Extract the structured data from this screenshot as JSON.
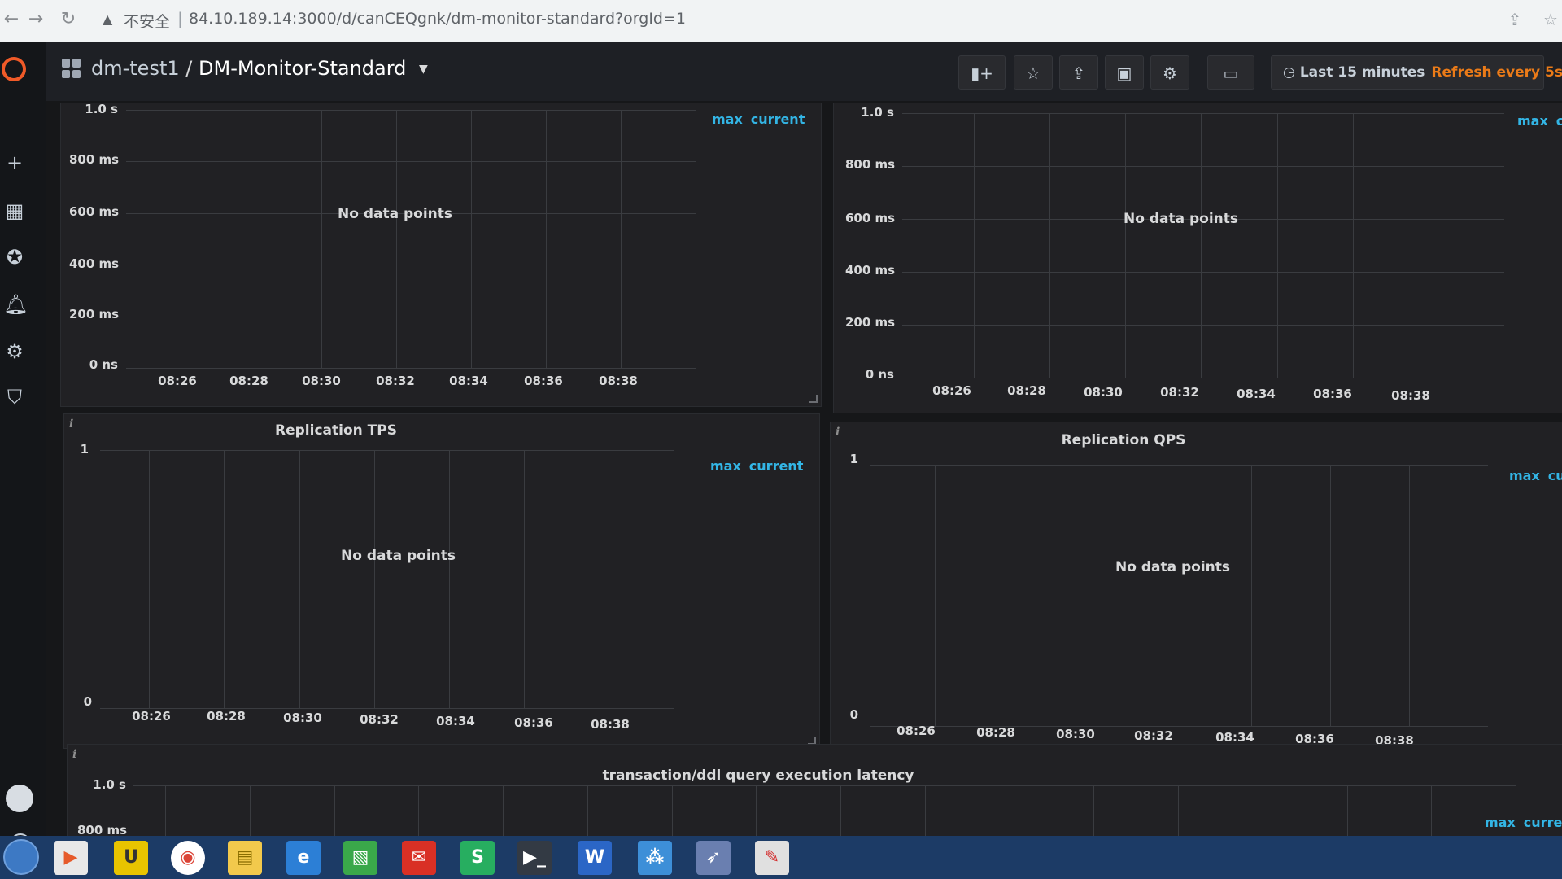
{
  "browser": {
    "security_label": "不安全",
    "url": "84.10.189.14:3000/d/canCEQgnk/dm-monitor-standard?orgId=1"
  },
  "topbar": {
    "folder": "dm-test1",
    "separator": "/",
    "dashboard_title": "DM-Monitor-Standard",
    "time_range": "Last 15 minutes",
    "refresh": "Refresh every 5s"
  },
  "panels": {
    "p1": {
      "title": "",
      "yticks": [
        "1.0 s",
        "800 ms",
        "600 ms",
        "400 ms",
        "200 ms",
        "0 ns"
      ],
      "xticks": [
        "08:26",
        "08:28",
        "08:30",
        "08:32",
        "08:34",
        "08:36",
        "08:38"
      ],
      "legend": [
        "max",
        "current"
      ],
      "nodata": "No data points"
    },
    "p2": {
      "title": "",
      "yticks": [
        "1.0 s",
        "800 ms",
        "600 ms",
        "400 ms",
        "200 ms",
        "0 ns"
      ],
      "xticks": [
        "08:26",
        "08:28",
        "08:30",
        "08:32",
        "08:34",
        "08:36",
        "08:38"
      ],
      "legend": [
        "max",
        "c"
      ],
      "nodata": "No data points"
    },
    "p3": {
      "title": "Replication TPS",
      "yticks": [
        "1",
        "0"
      ],
      "xticks": [
        "08:26",
        "08:28",
        "08:30",
        "08:32",
        "08:34",
        "08:36",
        "08:38"
      ],
      "legend": [
        "max",
        "current"
      ],
      "nodata": "No data points"
    },
    "p4": {
      "title": "Replication QPS",
      "yticks": [
        "1",
        "0"
      ],
      "xticks": [
        "08:26",
        "08:28",
        "08:30",
        "08:32",
        "08:34",
        "08:36",
        "08:38"
      ],
      "legend": [
        "max",
        "cur"
      ],
      "nodata": "No data points"
    },
    "p5": {
      "title": "transaction/ddl query execution latency",
      "yticks": [
        "1.0 s",
        "800 ms"
      ],
      "legend": [
        "max",
        "current"
      ]
    }
  },
  "icons": {
    "info": "i",
    "help": "?"
  }
}
